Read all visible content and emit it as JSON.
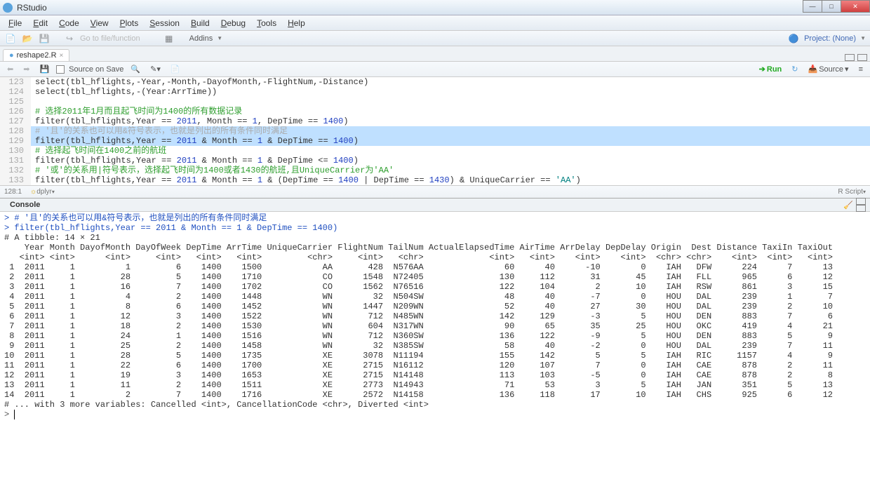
{
  "window": {
    "title": "RStudio"
  },
  "menu": [
    "File",
    "Edit",
    "Code",
    "View",
    "Plots",
    "Session",
    "Build",
    "Debug",
    "Tools",
    "Help"
  ],
  "toolbar": {
    "addins": "Addins",
    "project": "Project: (None)",
    "goto": "Go to file/function"
  },
  "tab": {
    "name": "reshape2.R"
  },
  "editor_toolbar": {
    "source_on_save": "Source on Save",
    "run": "Run",
    "source": "Source"
  },
  "editor_lines": [
    {
      "n": "123",
      "text": "select(tbl_hflights,-Year,-Month,-DayofMonth,-FlightNum,-Distance)",
      "cls": ""
    },
    {
      "n": "124",
      "text": "select(tbl_hflights,-(Year:ArrTime))",
      "cls": ""
    },
    {
      "n": "125",
      "text": "",
      "cls": ""
    },
    {
      "n": "126",
      "text": "# 选择2011年1月而且起飞时间为1400的所有数据记录",
      "cls": "comment"
    },
    {
      "n": "127",
      "text": "filter(tbl_hflights,Year == 2011, Month == 1, DepTime == 1400)",
      "cls": ""
    },
    {
      "n": "128",
      "text": "# '且'的关系也可以用&符号表示，也就是列出的所有条件同时满足",
      "cls": "comment2",
      "hl": true
    },
    {
      "n": "129",
      "text": "filter(tbl_hflights,Year == 2011 & Month == 1 & DepTime == 1400)",
      "cls": "",
      "hl": true
    },
    {
      "n": "130",
      "text": "# 选择起飞时间在1400之前的航班",
      "cls": "comment"
    },
    {
      "n": "131",
      "text": "filter(tbl_hflights,Year == 2011 & Month == 1 & DepTime <= 1400)",
      "cls": ""
    },
    {
      "n": "132",
      "text": "# '或'的关系用|符号表示，选择起飞时间为1400或者1430的航班,且UniqueCarrier为'AA'",
      "cls": "comment"
    },
    {
      "n": "133",
      "text": "filter(tbl_hflights,Year == 2011 & Month == 1 & (DepTime == 1400 | DepTime == 1430) & UniqueCarrier == 'AA')",
      "cls": ""
    }
  ],
  "editor_status": {
    "pos": "128:1",
    "breadcrumb": "dplyr ",
    "lang": "R Script"
  },
  "console_tab": "Console",
  "console_lines": [
    {
      "text": "> # '且'的关系也可以用&符号表示，也就是列出的所有条件同时满足",
      "cls": "prompt-line"
    },
    {
      "text": "> filter(tbl_hflights,Year == 2011 & Month == 1 & DepTime == 1400)",
      "cls": "prompt-line"
    },
    {
      "text": "# A tibble: 14 × 21",
      "cls": ""
    }
  ],
  "chart_data": {
    "type": "table",
    "columns": [
      "",
      "Year",
      "Month",
      "DayofMonth",
      "DayOfWeek",
      "DepTime",
      "ArrTime",
      "UniqueCarrier",
      "FlightNum",
      "TailNum",
      "ActualElapsedTime",
      "AirTime",
      "ArrDelay",
      "DepDelay",
      "Origin",
      "Dest",
      "Distance",
      "TaxiIn",
      "TaxiOut"
    ],
    "types": [
      "",
      "<int>",
      "<int>",
      "<int>",
      "<int>",
      "<int>",
      "<int>",
      "<chr>",
      "<int>",
      "<chr>",
      "<int>",
      "<int>",
      "<int>",
      "<int>",
      "<chr>",
      "<chr>",
      "<int>",
      "<int>",
      "<int>"
    ],
    "rows": [
      [
        "1",
        2011,
        1,
        1,
        6,
        1400,
        1500,
        "AA",
        428,
        "N576AA",
        60,
        40,
        -10,
        0,
        "IAH",
        "DFW",
        224,
        7,
        13
      ],
      [
        "2",
        2011,
        1,
        28,
        5,
        1400,
        1710,
        "CO",
        1548,
        "N72405",
        130,
        112,
        31,
        45,
        "IAH",
        "FLL",
        965,
        6,
        12
      ],
      [
        "3",
        2011,
        1,
        16,
        7,
        1400,
        1702,
        "CO",
        1562,
        "N76516",
        122,
        104,
        2,
        10,
        "IAH",
        "RSW",
        861,
        3,
        15
      ],
      [
        "4",
        2011,
        1,
        4,
        2,
        1400,
        1448,
        "WN",
        32,
        "N504SW",
        48,
        40,
        -7,
        0,
        "HOU",
        "DAL",
        239,
        1,
        7
      ],
      [
        "5",
        2011,
        1,
        8,
        6,
        1400,
        1452,
        "WN",
        1447,
        "N209WN",
        52,
        40,
        27,
        30,
        "HOU",
        "DAL",
        239,
        2,
        10
      ],
      [
        "6",
        2011,
        1,
        12,
        3,
        1400,
        1522,
        "WN",
        712,
        "N485WN",
        142,
        129,
        -3,
        5,
        "HOU",
        "DEN",
        883,
        7,
        6
      ],
      [
        "7",
        2011,
        1,
        18,
        2,
        1400,
        1530,
        "WN",
        604,
        "N317WN",
        90,
        65,
        35,
        25,
        "HOU",
        "OKC",
        419,
        4,
        21
      ],
      [
        "8",
        2011,
        1,
        24,
        1,
        1400,
        1516,
        "WN",
        712,
        "N360SW",
        136,
        122,
        -9,
        5,
        "HOU",
        "DEN",
        883,
        5,
        9
      ],
      [
        "9",
        2011,
        1,
        25,
        2,
        1400,
        1458,
        "WN",
        32,
        "N385SW",
        58,
        40,
        -2,
        0,
        "HOU",
        "DAL",
        239,
        7,
        11
      ],
      [
        "10",
        2011,
        1,
        28,
        5,
        1400,
        1735,
        "XE",
        3078,
        "N11194",
        155,
        142,
        5,
        5,
        "IAH",
        "RIC",
        1157,
        4,
        9
      ],
      [
        "11",
        2011,
        1,
        22,
        6,
        1400,
        1700,
        "XE",
        2715,
        "N16112",
        120,
        107,
        7,
        0,
        "IAH",
        "CAE",
        878,
        2,
        11
      ],
      [
        "12",
        2011,
        1,
        19,
        3,
        1400,
        1653,
        "XE",
        2715,
        "N14148",
        113,
        103,
        -5,
        0,
        "IAH",
        "CAE",
        878,
        2,
        8
      ],
      [
        "13",
        2011,
        1,
        11,
        2,
        1400,
        1511,
        "XE",
        2773,
        "N14943",
        71,
        53,
        3,
        5,
        "IAH",
        "JAN",
        351,
        5,
        13
      ],
      [
        "14",
        2011,
        1,
        2,
        7,
        1400,
        1716,
        "XE",
        2572,
        "N14158",
        136,
        118,
        17,
        10,
        "IAH",
        "CHS",
        925,
        6,
        12
      ]
    ],
    "footer": "# ... with 3 more variables: Cancelled <int>, CancellationCode <chr>, Diverted <int>"
  },
  "prompt": "> "
}
